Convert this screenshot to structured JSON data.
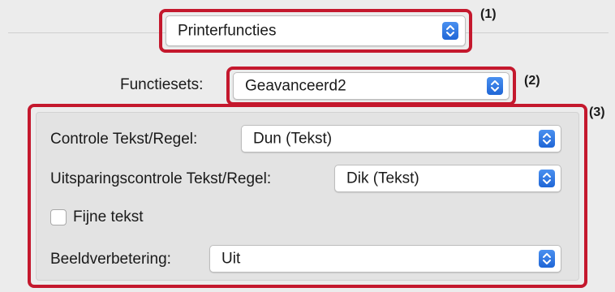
{
  "printer_functions": {
    "value": "Printerfuncties"
  },
  "function_sets": {
    "label": "Functiesets:",
    "value": "Geavanceerd2"
  },
  "markers": [
    "(1)",
    "(2)",
    "(3)"
  ],
  "settings": {
    "text_line_control": {
      "label": "Controle Tekst/Regel:",
      "value": "Dun (Tekst)"
    },
    "knockout_control": {
      "label": "Uitsparingscontrole Tekst/Regel:",
      "value": "Dik (Tekst)"
    },
    "fine_text": {
      "label": "Fijne tekst",
      "checked": false
    },
    "image_enhancement": {
      "label": "Beeldverbetering:",
      "value": "Uit"
    }
  },
  "colors": {
    "highlight": "#c4182d",
    "accent": "#1f66d6"
  },
  "icons": [
    "chevron-up-down-icon",
    "checkbox-icon"
  ]
}
